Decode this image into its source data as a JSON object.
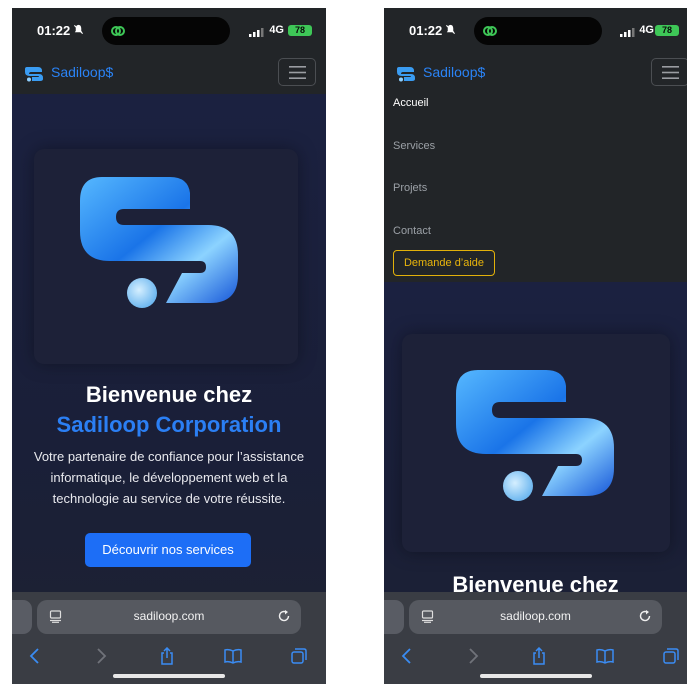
{
  "status": {
    "time": "01:22",
    "network": "4G",
    "battery": "78"
  },
  "navbar": {
    "brand": "Sadiloop$"
  },
  "menu": {
    "items": [
      {
        "label": "Accueil",
        "active": true
      },
      {
        "label": "Services",
        "active": false
      },
      {
        "label": "Projets",
        "active": false
      },
      {
        "label": "Contact",
        "active": false
      }
    ],
    "help_button": "Demande d’aide"
  },
  "hero": {
    "title_line1": "Bienvenue chez",
    "title_line2": "Sadiloop Corporation",
    "lead": "Votre partenaire de confiance pour l’assistance informatique, le développement web et la technologie au service de votre réussite.",
    "cta": "Découvrir nos services"
  },
  "browser": {
    "url": "sadiloop.com"
  },
  "colors": {
    "accent": "#2b7ff4",
    "button": "#1d6ef6",
    "help_border": "#e2b10a",
    "battery": "#3ec757"
  }
}
